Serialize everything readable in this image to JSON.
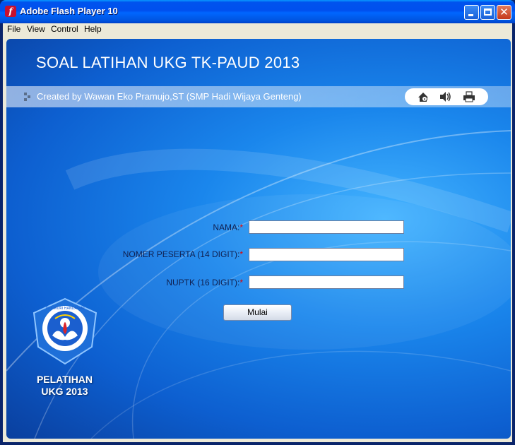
{
  "window": {
    "title": "Adobe Flash Player 10",
    "menu": [
      "File",
      "View",
      "Control",
      "Help"
    ]
  },
  "header": {
    "title": "SOAL LATIHAN UKG TK-PAUD 2013",
    "credit": "Created by Wawan Eko Pramujo,ST (SMP Hadi Wijaya Genteng)"
  },
  "toolbar_icons": [
    "info-icon",
    "speaker-icon",
    "printer-icon"
  ],
  "form": {
    "nama_label": "NAMA:",
    "nomer_label": "NOMER PESERTA (14 DIGIT):",
    "nuptk_label": "NUPTK (16 DIGIT):",
    "required_mark": "*",
    "nama_value": "",
    "nomer_value": "",
    "nuptk_value": "",
    "submit_label": "Mulai"
  },
  "logo": {
    "ring_text": "TUT WURI HANDAYANI",
    "caption_line1": "PELATIHAN",
    "caption_line2": "UKG 2013"
  },
  "colors": {
    "stage_blue": "#1a86ec",
    "required": "#e00000",
    "titlebar": "#0053ee"
  }
}
